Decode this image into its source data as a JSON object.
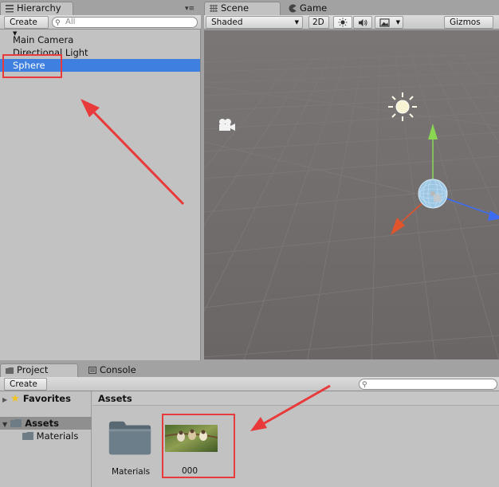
{
  "hierarchy": {
    "tab_label": "Hierarchy",
    "create_label": "Create",
    "search_placeholder": "All",
    "items": [
      {
        "label": "Main Camera"
      },
      {
        "label": "Directional Light"
      },
      {
        "label": "Sphere"
      }
    ]
  },
  "scene": {
    "tab_scene": "Scene",
    "tab_game": "Game",
    "shading_label": "Shaded",
    "mode_2d_label": "2D",
    "gizmos_label": "Gizmos"
  },
  "project": {
    "tab_project": "Project",
    "tab_console": "Console",
    "create_label": "Create",
    "favorites_label": "Favorites",
    "assets_label": "Assets",
    "materials_label": "Materials",
    "assets_header": "Assets",
    "grid_items": [
      {
        "label": "Materials",
        "icon": "folder-icon"
      },
      {
        "label": "000",
        "icon": "image-thumbnail"
      }
    ]
  },
  "colors": {
    "selection": "#3d80df",
    "annotation": "#e83a3a",
    "scene_bg": "#6e6a69"
  }
}
